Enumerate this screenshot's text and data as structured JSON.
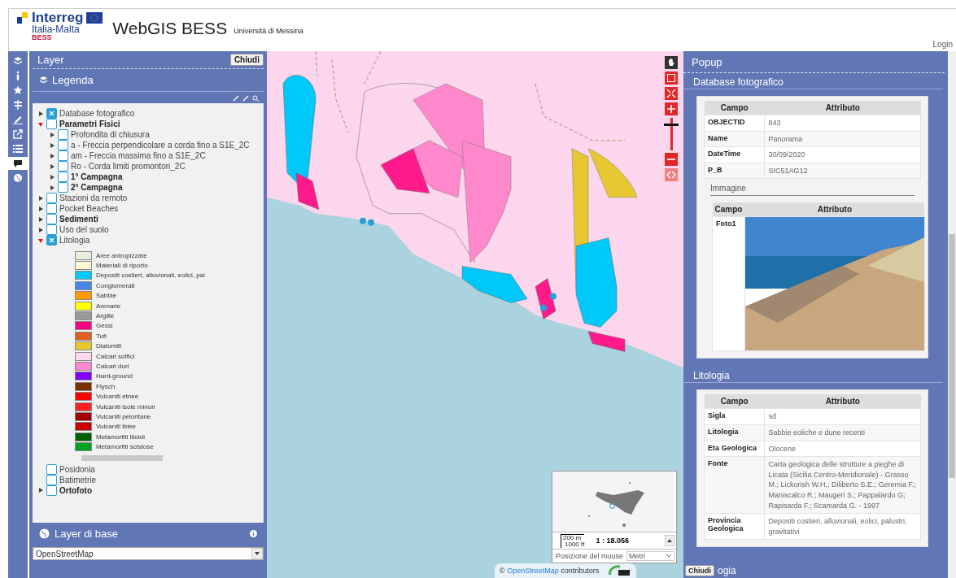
{
  "header": {
    "logo": {
      "brand": "Interreg",
      "region": "Italia-Malta",
      "project": "BESS"
    },
    "title": "WebGIS BESS",
    "subtitle": "Università di Messina",
    "login": "Login"
  },
  "toolbar": [
    {
      "kind": "layers",
      "selected": false
    },
    {
      "kind": "info",
      "selected": false
    },
    {
      "kind": "star",
      "selected": false
    },
    {
      "kind": "signpost",
      "selected": false
    },
    {
      "kind": "pencil",
      "selected": false
    },
    {
      "kind": "share",
      "selected": false
    },
    {
      "kind": "list",
      "selected": false
    },
    {
      "kind": "comment",
      "selected": true
    },
    {
      "kind": "globe",
      "selected": false
    }
  ],
  "layer_panel": {
    "title": "Layer",
    "close": "Chiudi",
    "legend_title": "Legenda",
    "tree": [
      {
        "label": "Database fotografico",
        "kind": "group",
        "expanded": false,
        "checked": true,
        "bold": false
      },
      {
        "label": "Parametri Fisici",
        "kind": "group",
        "expanded": true,
        "checked": false,
        "bold": true,
        "children": [
          {
            "label": "Profondita di chiusura",
            "kind": "group",
            "expanded": false,
            "checked": false,
            "bold": false
          },
          {
            "label": "a - Freccia perpendicolare a corda fino a S1E_2C",
            "kind": "group",
            "expanded": false,
            "checked": false,
            "bold": false
          },
          {
            "label": "am - Freccia massima fino a S1E_2C",
            "kind": "group",
            "expanded": false,
            "checked": false,
            "bold": false
          },
          {
            "label": "Ro - Corda limiti promontori_2C",
            "kind": "group",
            "expanded": false,
            "checked": false,
            "bold": false
          },
          {
            "label": "1° Campagna",
            "kind": "group",
            "expanded": false,
            "checked": false,
            "bold": true
          },
          {
            "label": "2° Campagna",
            "kind": "group",
            "expanded": false,
            "checked": false,
            "bold": true
          }
        ]
      },
      {
        "label": "Stazioni da remoto",
        "kind": "group",
        "expanded": false,
        "checked": false,
        "bold": false
      },
      {
        "label": "Pocket Beaches",
        "kind": "group",
        "expanded": false,
        "checked": false,
        "bold": false
      },
      {
        "label": "Sedimenti",
        "kind": "group",
        "expanded": false,
        "checked": false,
        "bold": true
      },
      {
        "label": "Uso del suolo",
        "kind": "group",
        "expanded": false,
        "checked": false,
        "bold": false
      },
      {
        "label": "Litologia",
        "kind": "group",
        "expanded": true,
        "checked": true,
        "bold": false,
        "legend": [
          {
            "label": "Aree antropizzate",
            "color": "#e6f0dc"
          },
          {
            "label": "Materiali di riporto",
            "color": "#fdf8d2"
          },
          {
            "label": "Depositi costieri, alluvionali, eolici, pal",
            "color": "#00c8f8"
          },
          {
            "label": "Conglomerati",
            "color": "#4a86e8"
          },
          {
            "label": "Sabbie",
            "color": "#ff9900"
          },
          {
            "label": "Arenarie",
            "color": "#ffff00"
          },
          {
            "label": "Argille",
            "color": "#999999"
          },
          {
            "label": "Gessi",
            "color": "#ff0080"
          },
          {
            "label": "Tufi",
            "color": "#e06020"
          },
          {
            "label": "Diatomiti",
            "color": "#e8c830"
          },
          {
            "label": "Calcari soffici",
            "color": "#ffd8f0"
          },
          {
            "label": "Calcari duri",
            "color": "#ff88cc"
          },
          {
            "label": "Hard-ground",
            "color": "#8000ff"
          },
          {
            "label": "Flysch",
            "color": "#7a3000"
          },
          {
            "label": "Vulcaniti etnee",
            "color": "#ff0000"
          },
          {
            "label": "Vulcaniti isole minori",
            "color": "#ff2020"
          },
          {
            "label": "Vulcaniti peloritane",
            "color": "#a00000"
          },
          {
            "label": "Vulcaniti iblee",
            "color": "#cc0000"
          },
          {
            "label": "Metamorfiti litoidi",
            "color": "#006000"
          },
          {
            "label": "Metamorfiti scistose",
            "color": "#00a020"
          }
        ]
      },
      {
        "label": "Posidonia",
        "kind": "layer",
        "checked": false,
        "bold": false
      },
      {
        "label": "Batimetrie",
        "kind": "layer",
        "checked": false,
        "bold": false
      },
      {
        "label": "Ortofoto",
        "kind": "group",
        "expanded": false,
        "checked": false,
        "bold": true
      }
    ],
    "base_title": "Layer di base",
    "base_select": "OpenStreetMap"
  },
  "map": {
    "zoom_slider": {
      "level": 0.75
    },
    "overview": {
      "scale_m": "200 m",
      "scale_ft": "1000 ft",
      "ratio": "1 : 18.056",
      "mouse_label": "Posizione del mouse",
      "units": "Metri"
    },
    "attribution": {
      "prefix": "©",
      "link": "OpenStreetMap",
      "text": "contributors"
    }
  },
  "popup": {
    "title": "Popup",
    "sections": [
      {
        "title": "Database fotografico",
        "columns": [
          "Campo",
          "Attributo"
        ],
        "rows": [
          {
            "field": "OBJECTID",
            "value": "843"
          },
          {
            "field": "Name",
            "value": "Panorama"
          },
          {
            "field": "DateTime",
            "value": "30/09/2020"
          },
          {
            "field": "P_B",
            "value": "SIC51AG12"
          }
        ],
        "subsection": {
          "title": "Immagine",
          "columns": [
            "Campo",
            "Attributo"
          ],
          "rows": [
            {
              "field": "Foto1",
              "kind": "photo"
            }
          ]
        }
      },
      {
        "title": "Litologia",
        "columns": [
          "Campo",
          "Attributo"
        ],
        "rows": [
          {
            "field": "Sigla",
            "value": "sd"
          },
          {
            "field": "Litologia",
            "value": "Sabbie eoliche e dune recenti"
          },
          {
            "field": "Eta Geologica",
            "value": "Olocene"
          },
          {
            "field": "Fonte",
            "value": "Carta geologica delle strutture a pieghe di Licata (Sicilia Centro-Meridionale) - Grasso M.; Lickorish W.H.; Diliberto S.E.; Geremia F.; Maniscalco R.; Maugeri S.; Pappalardo G; Rapisarda F.; Scamarda G. - 1997"
          },
          {
            "field": "Provincia Geologica",
            "value": "Depositi costieri, alluvionali, eolici, palustri, gravitativi"
          }
        ]
      }
    ],
    "close": "Chiudi",
    "cut_title": "ogia"
  }
}
